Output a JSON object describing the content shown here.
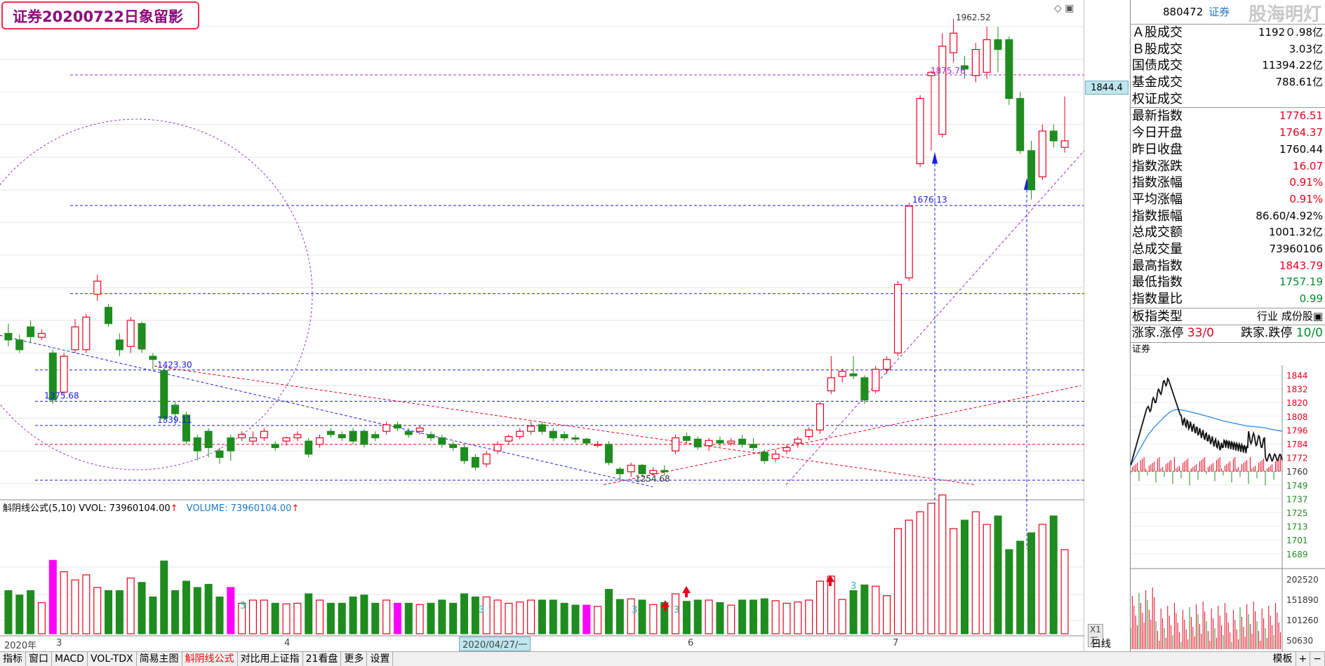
{
  "title": "证券20200722日象留影",
  "current_price_tag": "1844.4",
  "top_icons": "◇ ▣",
  "indicator": {
    "name": "斛阴线公式(5,10) VVOL: 73960104.00",
    "arrow": "↑",
    "volume_text": "VOLUME: 73960104.00",
    "volume_arrow": "↑"
  },
  "date_axis": {
    "year": "2020年",
    "m3": "3",
    "m4": "4",
    "selected": "2020/04/27/一",
    "m5": "5",
    "m6": "6",
    "m7": "7",
    "unit": "X1万"
  },
  "bottom_tabs": [
    "指标",
    "窗口",
    "MACD",
    "VOL-TDX",
    "简易主图",
    "斛阴线公式",
    "对比用上证指",
    "21看盘",
    "更多",
    "设置"
  ],
  "bottom_active": "斛阴线公式",
  "bottom_right": [
    "模板",
    "+",
    "−"
  ],
  "side_tab": "日线",
  "colors": {
    "up": "#e8001c",
    "down": "#1e8c1e",
    "magenta": "#ff00ff",
    "blue_line": "#1a1ae6",
    "red_line": "#e8001c",
    "purple": "#9b30c8"
  },
  "chart_data": {
    "type": "candlestick",
    "price_axis": [
      1950,
      1900,
      1850,
      1800,
      1750,
      1700,
      1650,
      1600,
      1550,
      1500,
      1450,
      1400,
      1350,
      1300,
      1250
    ],
    "volume_axis": [
      "10000",
      "7500",
      "5000"
    ],
    "annotations": [
      "1962.52",
      "1875.76",
      "1676.13",
      "1423.30",
      "1375.68",
      "1339.11",
      "1254.68"
    ],
    "level_lines": [
      1876,
      1676,
      1541,
      1424,
      1376,
      1339,
      1310,
      1255
    ],
    "signal_marks": [
      "3",
      "3",
      "3",
      "3",
      "3"
    ],
    "candles": [
      [
        1480,
        1470,
        1495,
        1460
      ],
      [
        1470,
        1455,
        1478,
        1450
      ],
      [
        1490,
        1475,
        1500,
        1465
      ],
      [
        1474,
        1480,
        1486,
        1470
      ],
      [
        1450,
        1378,
        1455,
        1372
      ],
      [
        1390,
        1445,
        1450,
        1385
      ],
      [
        1455,
        1490,
        1502,
        1450
      ],
      [
        1455,
        1505,
        1510,
        1450
      ],
      [
        1540,
        1560,
        1570,
        1530
      ],
      [
        1520,
        1495,
        1525,
        1490
      ],
      [
        1470,
        1455,
        1480,
        1445
      ],
      [
        1460,
        1500,
        1505,
        1450
      ],
      [
        1495,
        1456,
        1498,
        1450
      ],
      [
        1445,
        1440,
        1450,
        1425
      ],
      [
        1423,
        1350,
        1427,
        1345
      ],
      [
        1370,
        1357,
        1375,
        1340
      ],
      [
        1355,
        1315,
        1360,
        1310
      ],
      [
        1320,
        1300,
        1325,
        1285
      ],
      [
        1330,
        1305,
        1335,
        1290
      ],
      [
        1300,
        1290,
        1305,
        1280
      ],
      [
        1320,
        1300,
        1325,
        1285
      ],
      [
        1320,
        1325,
        1330,
        1315
      ],
      [
        1315,
        1320,
        1330,
        1310
      ],
      [
        1320,
        1330,
        1335,
        1315
      ],
      [
        1310,
        1305,
        1315,
        1300
      ],
      [
        1315,
        1320,
        1322,
        1308
      ],
      [
        1320,
        1325,
        1330,
        1315
      ],
      [
        1315,
        1295,
        1320,
        1290
      ],
      [
        1310,
        1320,
        1325,
        1305
      ],
      [
        1330,
        1325,
        1335,
        1320
      ],
      [
        1325,
        1320,
        1330,
        1315
      ],
      [
        1330,
        1315,
        1335,
        1310
      ],
      [
        1330,
        1310,
        1333,
        1305
      ],
      [
        1325,
        1320,
        1330,
        1315
      ],
      [
        1330,
        1340,
        1345,
        1325
      ],
      [
        1340,
        1335,
        1345,
        1330
      ],
      [
        1330,
        1325,
        1335,
        1320
      ],
      [
        1330,
        1335,
        1338,
        1325
      ],
      [
        1325,
        1320,
        1330,
        1315
      ],
      [
        1320,
        1310,
        1325,
        1305
      ],
      [
        1310,
        1305,
        1315,
        1300
      ],
      [
        1305,
        1285,
        1310,
        1280
      ],
      [
        1290,
        1275,
        1295,
        1270
      ],
      [
        1280,
        1295,
        1300,
        1275
      ],
      [
        1300,
        1310,
        1315,
        1295
      ],
      [
        1315,
        1322,
        1325,
        1310
      ],
      [
        1322,
        1330,
        1335,
        1318
      ],
      [
        1330,
        1338,
        1345,
        1325
      ],
      [
        1340,
        1330,
        1345,
        1325
      ],
      [
        1330,
        1320,
        1335,
        1315
      ],
      [
        1325,
        1320,
        1330,
        1315
      ],
      [
        1320,
        1318,
        1325,
        1313
      ],
      [
        1318,
        1312,
        1320,
        1308
      ],
      [
        1310,
        1310,
        1315,
        1305
      ],
      [
        1310,
        1282,
        1315,
        1278
      ],
      [
        1272,
        1265,
        1276,
        1255
      ],
      [
        1268,
        1278,
        1282,
        1260
      ],
      [
        1278,
        1265,
        1280,
        1260
      ],
      [
        1265,
        1270,
        1275,
        1262
      ],
      [
        1270,
        1268,
        1278,
        1262
      ],
      [
        1300,
        1320,
        1325,
        1295
      ],
      [
        1322,
        1316,
        1328,
        1310
      ],
      [
        1318,
        1306,
        1322,
        1302
      ],
      [
        1308,
        1316,
        1320,
        1300
      ],
      [
        1316,
        1312,
        1322,
        1306
      ],
      [
        1312,
        1315,
        1320,
        1308
      ],
      [
        1318,
        1310,
        1325,
        1305
      ],
      [
        1310,
        1305,
        1320,
        1300
      ],
      [
        1298,
        1285,
        1302,
        1280
      ],
      [
        1288,
        1295,
        1302,
        1283
      ],
      [
        1300,
        1305,
        1310,
        1295
      ],
      [
        1312,
        1318,
        1322,
        1305
      ],
      [
        1322,
        1332,
        1336,
        1316
      ],
      [
        1332,
        1372,
        1376,
        1326
      ],
      [
        1392,
        1412,
        1445,
        1387
      ],
      [
        1414,
        1422,
        1426,
        1405
      ],
      [
        1418,
        1415,
        1445,
        1410
      ],
      [
        1412,
        1378,
        1416,
        1372
      ],
      [
        1392,
        1425,
        1430,
        1388
      ],
      [
        1425,
        1440,
        1445,
        1418
      ],
      [
        1450,
        1555,
        1560,
        1445
      ],
      [
        1565,
        1675,
        1680,
        1560
      ],
      [
        1740,
        1840,
        1845,
        1735
      ],
      [
        1875,
        1880,
        1882,
        1760
      ],
      [
        1785,
        1920,
        1940,
        1780
      ],
      [
        1910,
        1940,
        1962,
        1895
      ],
      [
        1890,
        1885,
        1905,
        1870
      ],
      [
        1875,
        1915,
        1925,
        1865
      ],
      [
        1880,
        1930,
        1950,
        1870
      ],
      [
        1930,
        1915,
        1950,
        1880
      ],
      [
        1930,
        1840,
        1935,
        1830
      ],
      [
        1840,
        1760,
        1850,
        1755
      ],
      [
        1760,
        1700,
        1775,
        1685
      ],
      [
        1720,
        1790,
        1800,
        1715
      ],
      [
        1790,
        1775,
        1800,
        1765
      ],
      [
        1765,
        1775,
        1843,
        1757
      ]
    ]
  },
  "sidebar": {
    "code": "880472",
    "category": "证券",
    "watermark": "股海明灯",
    "rows": [
      {
        "label": "Ａ股成交",
        "value": "1192０.98亿",
        "cls": ""
      },
      {
        "label": "Ｂ股成交",
        "value": "3.03亿",
        "cls": ""
      },
      {
        "label": "国债成交",
        "value": "11394.22亿",
        "cls": ""
      },
      {
        "label": "基金成交",
        "value": "788.61亿",
        "cls": ""
      },
      {
        "label": "权证成交",
        "value": "",
        "cls": ""
      },
      {
        "label": "最新指数",
        "value": "1776.51",
        "cls": "red"
      },
      {
        "label": "今日开盘",
        "value": "1764.37",
        "cls": "red"
      },
      {
        "label": "昨日收盘",
        "value": "1760.44",
        "cls": ""
      },
      {
        "label": "指数涨跌",
        "value": "16.07",
        "cls": "red"
      },
      {
        "label": "指数涨幅",
        "value": "0.91%",
        "cls": "red"
      },
      {
        "label": "平均涨幅",
        "value": "0.91%",
        "cls": "red"
      },
      {
        "label": "指数振幅",
        "value": "86.60/4.92%",
        "cls": ""
      },
      {
        "label": "总成交额",
        "value": "1001.32亿",
        "cls": ""
      },
      {
        "label": "总成交量",
        "value": "73960106",
        "cls": ""
      },
      {
        "label": "最高指数",
        "value": "1843.79",
        "cls": "red"
      },
      {
        "label": "最低指数",
        "value": "1757.19",
        "cls": "green"
      },
      {
        "label": "指数量比",
        "value": "0.99",
        "cls": "green"
      },
      {
        "label": "板指类型",
        "value": "行业 成份股▣",
        "cls": ""
      }
    ],
    "updown": {
      "rise_label": "涨家.涨停",
      "rise_value": "33/0",
      "fall_label": "跌家.跌停",
      "fall_value": "10/0"
    },
    "mini_title": "证券",
    "mini_axis": [
      "1844",
      "1832",
      "1820",
      "1808",
      "1796",
      "1784",
      "1772",
      "1760",
      "1749",
      "1737",
      "1725",
      "1713",
      "1701",
      "1689"
    ],
    "mini_vol_axis": [
      "202520",
      "151890",
      "101260",
      "50630"
    ]
  }
}
